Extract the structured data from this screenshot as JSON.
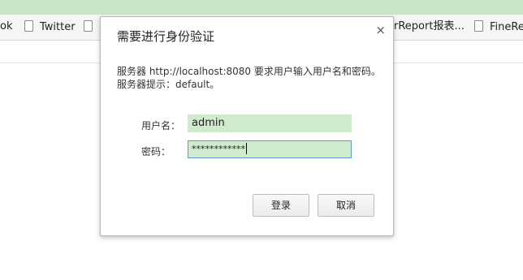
{
  "bookmarks": [
    {
      "label": "ok"
    },
    {
      "label": "Twitter"
    },
    {
      "label": "rReport报表..."
    },
    {
      "label": "FineRe"
    }
  ],
  "dialog": {
    "title": "需要进行身份验证",
    "close_label": "×",
    "message_line1": "服务器 http://localhost:8080 要求用户输入用户名和密码。",
    "message_line2": "服务器提示：default。",
    "username_label": "用户名：",
    "username_value": "admin",
    "password_label": "密码：",
    "password_masked": "************",
    "login_button": "登录",
    "cancel_button": "取消"
  },
  "colors": {
    "top_strip": "#c9e6c9",
    "autofill_field": "#cfeacd",
    "focus_border": "#5b9bd5"
  }
}
